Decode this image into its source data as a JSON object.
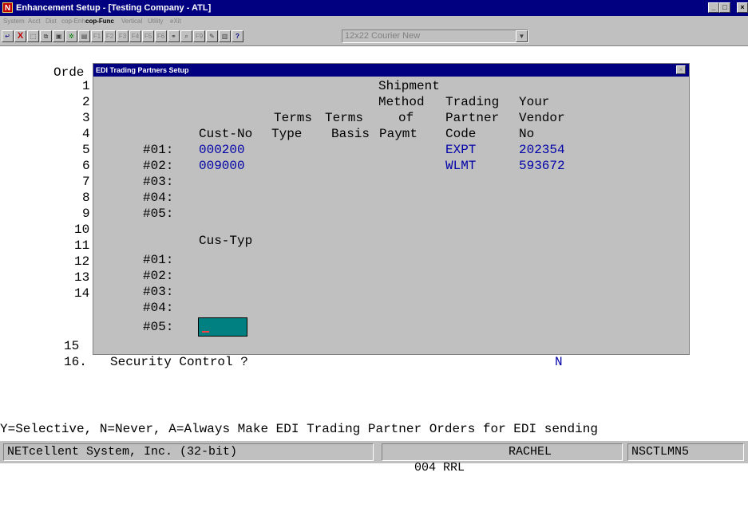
{
  "window": {
    "title": "Enhancement Setup - [Testing Company - ATL]",
    "app_icon": "netcellent-n-icon",
    "controls": [
      "minimize",
      "maximize",
      "close"
    ]
  },
  "menu": [
    "System",
    "Acct",
    "Dist",
    "cop-Enh",
    "cop-Func",
    "Vertical",
    "Utility",
    "eXit"
  ],
  "menu_active": "cop-Func",
  "toolbar": {
    "buttons": [
      "return-icon",
      "cancel-x-icon",
      "select-icon",
      "copy-icon",
      "paste-icon",
      "settings-icon",
      "document-icon",
      "F1",
      "F2",
      "F3",
      "F4",
      "F5",
      "F6",
      "binoculars-icon",
      "zoom-icon",
      "F9",
      "edit-icon",
      "book-icon",
      "help-icon"
    ],
    "font_value": "12x22 Courier New"
  },
  "screen": {
    "field_label": "Orde",
    "line_numbers": [
      "1",
      "2",
      "3",
      "4",
      "5",
      "6",
      "7",
      "8",
      "9",
      "10",
      "11",
      "12",
      "13",
      "14",
      "15"
    ],
    "line16_num": "16.",
    "line16_label": "Security Control ?",
    "line16_value": "N"
  },
  "dialog": {
    "title": "EDI Trading Partners Setup",
    "headers": {
      "shipment": "Shipment",
      "method": "Method",
      "trading": "Trading",
      "your": "Your",
      "terms1": "Terms",
      "terms2": "Terms",
      "of": "of",
      "partner": "Partner",
      "vendor": "Vendor",
      "cust_no": "Cust-No",
      "type": "Type",
      "basis": "Basis",
      "paymt": "Paymt",
      "code": "Code",
      "no": "No"
    },
    "rows": [
      {
        "label": "#01:",
        "cust_no": "000200",
        "partner_code": "EXPT",
        "vendor_no": "202354"
      },
      {
        "label": "#02:",
        "cust_no": "009000",
        "partner_code": "WLMT",
        "vendor_no": "593672"
      },
      {
        "label": "#03:",
        "cust_no": "",
        "partner_code": "",
        "vendor_no": ""
      },
      {
        "label": "#04:",
        "cust_no": "",
        "partner_code": "",
        "vendor_no": ""
      },
      {
        "label": "#05:",
        "cust_no": "",
        "partner_code": "",
        "vendor_no": ""
      }
    ],
    "cus_typ_header": "Cus-Typ",
    "cus_typ_rows": [
      "#01:",
      "#02:",
      "#03:",
      "#04:",
      "#05:"
    ]
  },
  "hint": "Y=Selective, N=Never, A=Always Make EDI Trading Partner Orders for EDI sending",
  "status": {
    "company": "NETcellent System, Inc. (32-bit)",
    "code": "004 RRL",
    "user": "RACHEL",
    "program": "NSCTLMN5"
  }
}
